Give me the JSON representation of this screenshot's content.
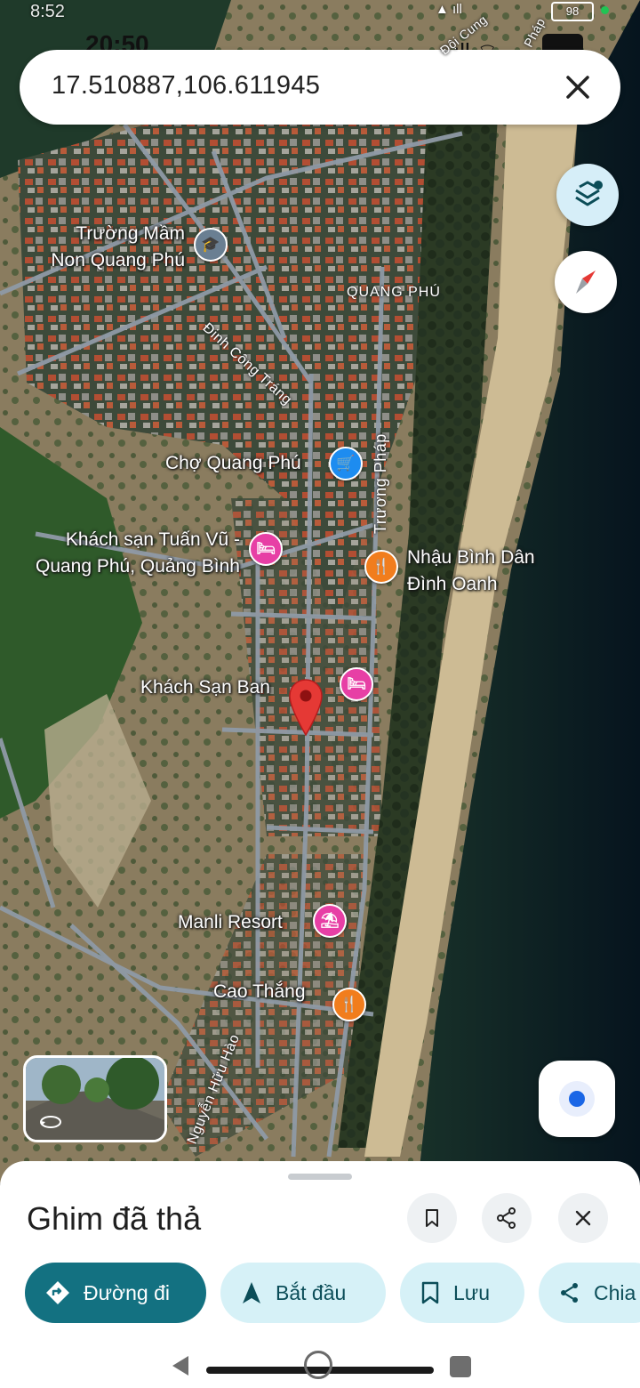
{
  "status": {
    "clock_back": "8:52",
    "clock_front": "20:50",
    "battery": "98"
  },
  "search": {
    "query": "17.510887,106.611945"
  },
  "map": {
    "places": [
      {
        "id": "school",
        "label": "Trường Mầm\nNon Quang Phú"
      },
      {
        "id": "market",
        "label": "Chợ Quang Phú"
      },
      {
        "id": "hotel-tuan-vu",
        "label": "Khách sạn Tuấn Vũ -\nQuang Phú, Quảng Bình"
      },
      {
        "id": "nhau-binh-dan",
        "label": "Nhậu Bình Dân\nĐình Oanh"
      },
      {
        "id": "hotel-ban",
        "label": "Khách Sạn Ban"
      },
      {
        "id": "manli",
        "label": "Manli Resort"
      },
      {
        "id": "cao-thang",
        "label": "Cao Thắng"
      }
    ],
    "streets": {
      "dinh_cong_trang": "Đinh Công Tráng",
      "truong_phap": "Trương Pháp",
      "nguyen_huu_hao": "Nguyễn Hữu Hào",
      "doi_cung": "Đội Cung",
      "phap_top": "Pháp"
    },
    "area": "QUANG PHÚ"
  },
  "icons": {
    "layers": "layers-icon",
    "compass": "compass-icon",
    "my_location": "my-location-icon",
    "close": "close-icon"
  },
  "sheet": {
    "title": "Ghim đã thả",
    "chips": {
      "directions": "Đường đi",
      "start": "Bắt đầu",
      "save": "Lưu",
      "share": "Chia"
    }
  },
  "colors": {
    "primary_chip": "#137181",
    "secondary_chip": "#d6f1f7",
    "pin": "#e53935"
  }
}
